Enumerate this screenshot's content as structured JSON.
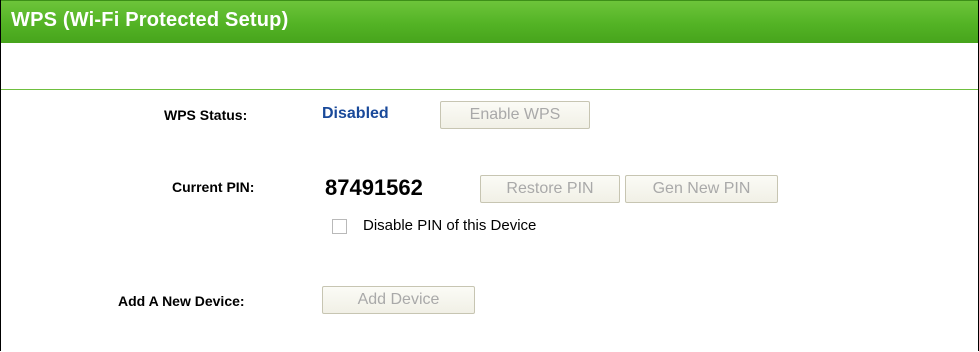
{
  "header": {
    "title": "WPS (Wi-Fi Protected Setup)"
  },
  "wps_status": {
    "label": "WPS Status:",
    "value": "Disabled",
    "enable_button": "Enable WPS"
  },
  "current_pin": {
    "label": "Current PIN:",
    "value": "87491562",
    "restore_button": "Restore PIN",
    "gen_button": "Gen New PIN",
    "disable_checkbox_label": "Disable PIN of this Device",
    "disable_checked": false
  },
  "add_device": {
    "label": "Add A New Device:",
    "button": "Add Device"
  },
  "colors": {
    "header_green": "#53b325",
    "status_blue": "#19499a",
    "disabled_text": "#a9a9a9"
  }
}
